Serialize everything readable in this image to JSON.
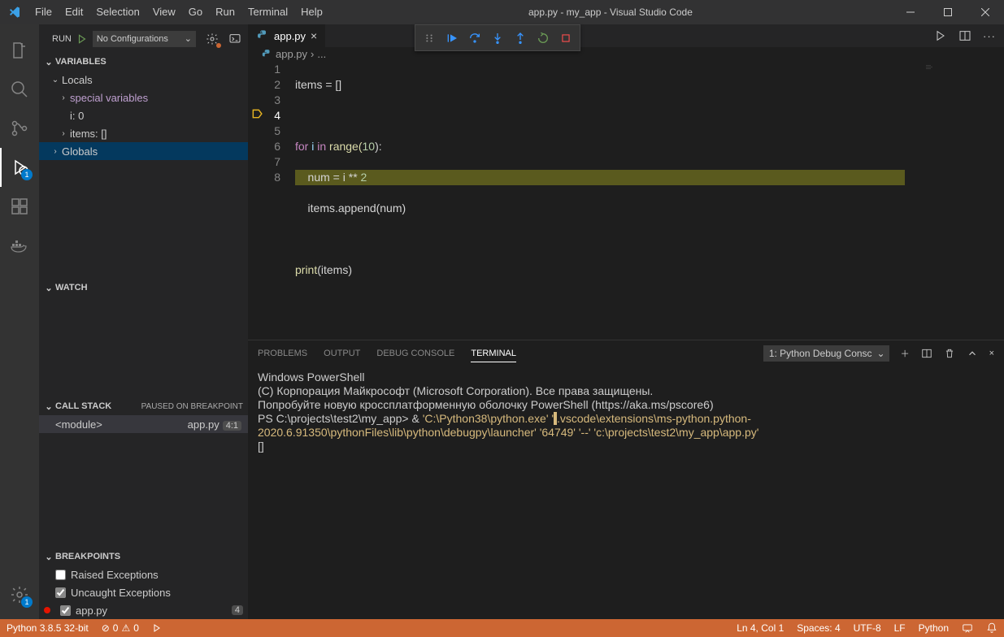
{
  "titlebar": {
    "menus": [
      "File",
      "Edit",
      "Selection",
      "View",
      "Go",
      "Run",
      "Terminal",
      "Help"
    ],
    "title": "app.py - my_app - Visual Studio Code"
  },
  "activitybar": {
    "debug_badge": "1",
    "settings_badge": "1"
  },
  "sidebar": {
    "run_label": "RUN",
    "config_label": "No Configurations",
    "variables_hdr": "VARIABLES",
    "locals_hdr": "Locals",
    "special_vars": "special variables",
    "var_i": "i: 0",
    "var_items": "items: []",
    "globals_hdr": "Globals",
    "watch_hdr": "WATCH",
    "callstack_hdr": "CALL STACK",
    "callstack_status": "PAUSED ON BREAKPOINT",
    "stack_frame": "<module>",
    "stack_file": "app.py",
    "stack_pos": "4:1",
    "breakpoints_hdr": "BREAKPOINTS",
    "bp_raised": "Raised Exceptions",
    "bp_uncaught": "Uncaught Exceptions",
    "bp_file": "app.py",
    "bp_file_line": "4"
  },
  "editor": {
    "tab_name": "app.py",
    "crumb1": "app.py",
    "crumb2": "...",
    "lines": [
      "1",
      "2",
      "3",
      "4",
      "5",
      "6",
      "7",
      "8"
    ],
    "code": {
      "l1": "items = []",
      "l3a": "for",
      "l3b": " i ",
      "l3c": "in",
      "l3d": " range(",
      "l3e": "10",
      "l3f": "):",
      "l4a": "    num = i ** ",
      "l4b": "2",
      "l5": "    items.append(num)",
      "l7a": "print",
      "l7b": "(items)"
    }
  },
  "panel": {
    "tabs": [
      "PROBLEMS",
      "OUTPUT",
      "DEBUG CONSOLE",
      "TERMINAL"
    ],
    "term_select": "1: Python Debug Consc",
    "terminal_lines": [
      "Windows PowerShell",
      "(C) Корпорация Майкрософт (Microsoft Corporation). Все права защищены.",
      "",
      "Попробуйте новую кроссплатформенную оболочку PowerShell (https://aka.ms/pscore6)"
    ],
    "ps_prompt": "PS C:\\projects\\test2\\my_app>  & ",
    "cmd_part1": "'C:\\Python38\\python.exe' '",
    "cmd_redact": "            ",
    "cmd_part2": ".vscode\\extensions\\ms-python.python-2020.6.91350\\pythonFiles\\lib\\python\\debugpy\\launcher' '64749' '--' 'c:\\projects\\test2\\my_app\\app.py'",
    "cursor": "[]"
  },
  "statusbar": {
    "python_version": "Python 3.8.5 32-bit",
    "errors": "0",
    "warnings": "0",
    "ln_col": "Ln 4, Col 1",
    "spaces": "Spaces: 4",
    "encoding": "UTF-8",
    "eol": "LF",
    "lang": "Python"
  }
}
